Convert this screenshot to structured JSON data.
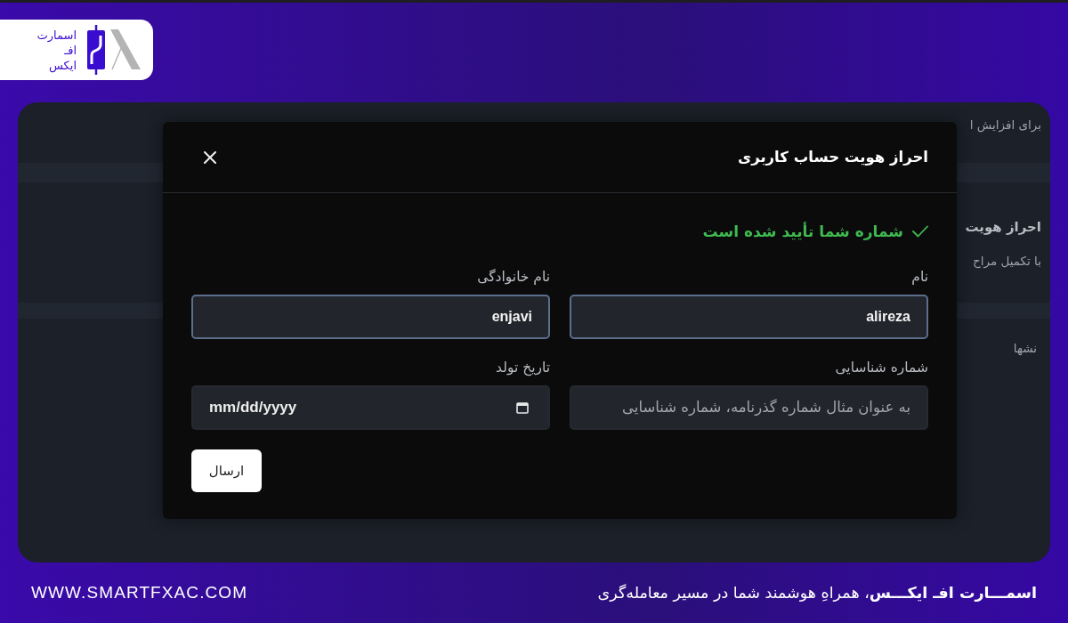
{
  "brand": {
    "logo_lines": [
      "اسمارت",
      "افـ",
      "ایکس"
    ]
  },
  "background_page": {
    "lines": [
      {
        "text": "برای افزایش ا",
        "kind": "note"
      },
      {
        "text": "احراز هویت",
        "kind": "heading"
      },
      {
        "text": "با تکمیل مراح",
        "kind": "note"
      },
      {
        "text": "نشها",
        "kind": "item"
      }
    ]
  },
  "modal": {
    "title": "احراز هویت حساب کاربری",
    "status": "شماره شما تأیید شده است",
    "fields": [
      {
        "label": "نام",
        "value": "alireza",
        "highlighted": true,
        "kind": "text"
      },
      {
        "label": "نام خانوادگی",
        "value": "enjavi",
        "highlighted": true,
        "kind": "text"
      },
      {
        "label": "شماره شناسایی",
        "placeholder": "به عنوان مثال شماره گذرنامه، شماره شناسایی",
        "highlighted": false,
        "kind": "text"
      },
      {
        "label": "تاریخ تولد",
        "placeholder": "mm/dd/yyyy",
        "highlighted": false,
        "kind": "date"
      }
    ],
    "submit": "ارسال"
  },
  "footer": {
    "website": "WWW.SMARTFXAC.COM",
    "tagline": "**اسمـــارت افـ ایکـــس**، همراهِ هوشمند شما در مسیر معامله‌گری"
  }
}
